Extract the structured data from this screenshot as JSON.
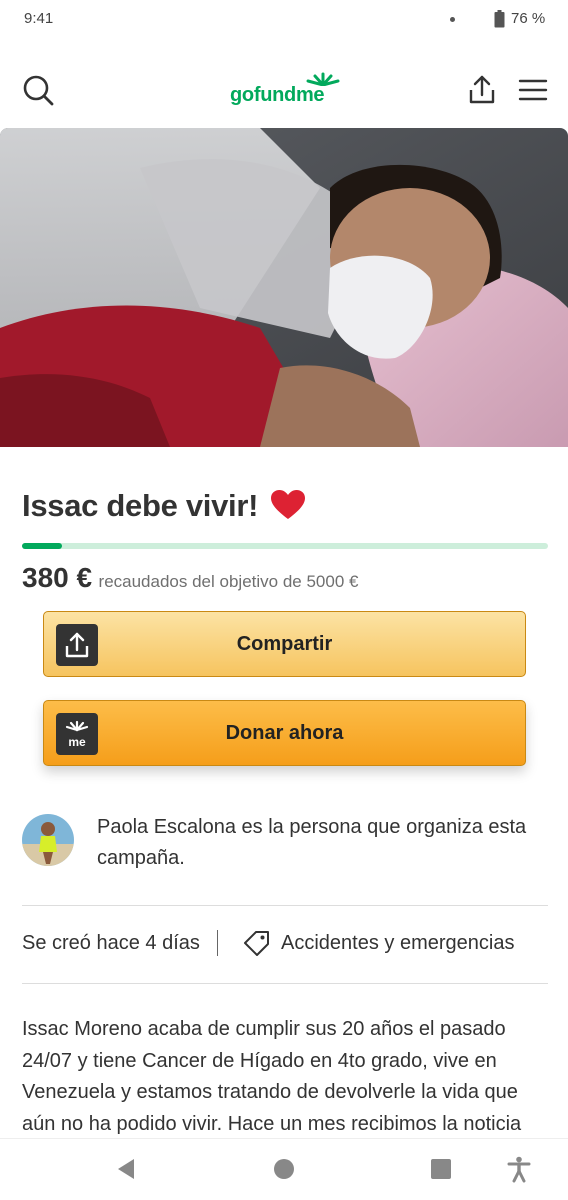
{
  "status_bar": {
    "time": "9:41",
    "battery": "76 %"
  },
  "header": {
    "logo_text": "gofundme",
    "brand_color": "#02a95c"
  },
  "campaign": {
    "title": "Issac debe vivir!",
    "raised_amount": "380 €",
    "raised_desc": "recaudados del objetivo de 5000 €",
    "progress_fraction": 0.076,
    "share_label": "Compartir",
    "donate_label": "Donar ahora",
    "organizer_text": "Paola Escalona es la persona que organiza esta campaña.",
    "created": "Se creó hace 4 días",
    "category": "Accidentes y emergencias",
    "story": "Issac Moreno acaba de cumplir sus 20 años el pasado 24/07 y tiene Cancer de Hígado en 4to grado, vive en Venezuela y estamos tratando de devolverle la vida que aún no ha podido vivir. Hace un mes recibimos la noticia"
  },
  "icons": {
    "search": "search-icon",
    "share": "share-icon",
    "menu": "hamburger-menu-icon",
    "heart": "heart-icon",
    "tag": "tag-icon",
    "battery": "battery-icon",
    "back": "back-icon",
    "home": "home-icon",
    "recents": "recents-icon",
    "accessibility": "accessibility-icon"
  }
}
